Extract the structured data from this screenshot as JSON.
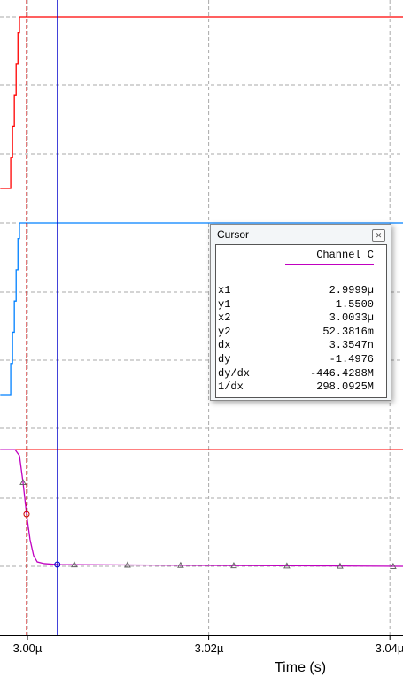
{
  "chart_data": {
    "type": "line",
    "xlabel": "Time (s)",
    "x_ticks": [
      "3.00µ",
      "3.02µ",
      "3.04µ"
    ],
    "x_tick_values_us": [
      3.0,
      3.02,
      3.04
    ],
    "xlim_us": [
      2.997,
      3.0415
    ],
    "grid": true,
    "panels": [
      {
        "series": [
          {
            "color": "#ff0000",
            "x_us": [
              2.997,
              2.99805,
              2.99815,
              2.99835,
              2.99855,
              2.99875,
              2.99895,
              2.99912,
              3.0415
            ],
            "y_v": [
              0,
              0,
              0.6,
              1.2,
              1.8,
              2.4,
              3.0,
              3.3,
              3.3
            ]
          }
        ],
        "ylim_v": [
          0,
          3.3
        ]
      },
      {
        "series": [
          {
            "color": "#0080ff",
            "x_us": [
              2.997,
              2.99805,
              2.99815,
              2.99835,
              2.99855,
              2.99875,
              2.99895,
              2.99912,
              3.0415
            ],
            "y_v": [
              0,
              0,
              0.6,
              1.2,
              1.8,
              2.4,
              3.0,
              3.3,
              3.3
            ]
          }
        ],
        "ylim_v": [
          0,
          3.3
        ]
      },
      {
        "series": [
          {
            "color": "#ff0000",
            "x_us": [
              2.997,
              3.0415
            ],
            "y_v": [
              3.47,
              3.47
            ]
          },
          {
            "name": "Channel C",
            "color": "#c000c0",
            "x_us": [
              2.997,
              2.99863,
              2.99912,
              2.99951,
              2.9999,
              3.00029,
              3.00068,
              3.00108,
              3.00186,
              3.0033,
              3.01799,
              3.0415
            ],
            "y_v": [
              3.47,
              3.47,
              3.29,
              2.5,
              1.55,
              0.79,
              0.32,
              0.13,
              0.08,
              0.052,
              0.03,
              0.0
            ]
          }
        ],
        "markers_x_us": [
          2.99951,
          3.00517,
          3.01104,
          3.0169,
          3.02277,
          3.02863,
          3.0345,
          3.04036
        ]
      }
    ],
    "cursors": [
      {
        "name": "cursor-1",
        "x_us": 2.9999,
        "color": "#cc0000",
        "style": "dashed"
      },
      {
        "name": "cursor-2",
        "x_us": 3.0033,
        "color": "#0000cc",
        "style": "solid"
      }
    ]
  },
  "cursor_dialog": {
    "title": "Cursor",
    "close_icon": "close-icon",
    "channel": "Channel C",
    "rows": [
      {
        "k": "x1",
        "v": "2.9999µ"
      },
      {
        "k": "y1",
        "v": "1.5500"
      },
      {
        "k": "x2",
        "v": "3.0033µ"
      },
      {
        "k": "y2",
        "v": "52.3816m"
      },
      {
        "k": "dx",
        "v": "3.3547n"
      },
      {
        "k": "dy",
        "v": "-1.4976"
      },
      {
        "k": "dy/dx",
        "v": "-446.4288M"
      },
      {
        "k": "1/dx",
        "v": "298.0925M"
      }
    ]
  }
}
